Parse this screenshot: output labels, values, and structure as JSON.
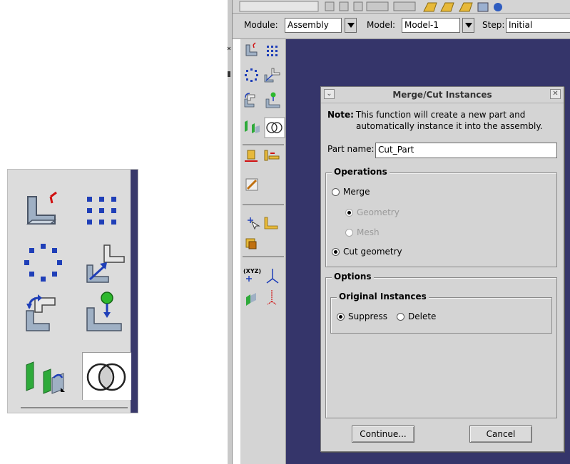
{
  "context_bar": {
    "module_label": "Module:",
    "module_value": "Assembly",
    "model_label": "Model:",
    "model_value": "Model-1",
    "step_label": "Step:",
    "step_value": "Initial"
  },
  "palette_tools": [
    {
      "icon": "create-instance-icon"
    },
    {
      "icon": "linear-pattern-icon"
    },
    {
      "icon": "radial-pattern-icon"
    },
    {
      "icon": "translate-instance-icon"
    },
    {
      "icon": "rotate-instance-icon"
    },
    {
      "icon": "translate-to-icon"
    },
    {
      "icon": "convert-constraints-icon"
    },
    {
      "icon": "merge-cut-instances-icon"
    }
  ],
  "dialog": {
    "title": "Merge/Cut Instances",
    "note_label": "Note:",
    "note_line1": "This function will create a new part and",
    "note_line2": "automatically instance it into the assembly.",
    "part_name_label": "Part name:",
    "part_name_value": "Cut_Part",
    "operations_label": "Operations",
    "merge_label": "Merge",
    "geometry_label": "Geometry",
    "mesh_label": "Mesh",
    "cut_geometry_label": "Cut geometry",
    "options_label": "Options",
    "original_instances_label": "Original Instances",
    "suppress_label": "Suppress",
    "delete_label": "Delete",
    "continue_label": "Continue...",
    "cancel_label": "Cancel",
    "selected_operation": "Cut geometry",
    "selected_original_instances": "Suppress"
  },
  "colors": {
    "canvas": "#35356a",
    "panel": "#d4d4d4",
    "icon_blue": "#1a3fbf",
    "icon_gray": "#9aa6b4"
  }
}
